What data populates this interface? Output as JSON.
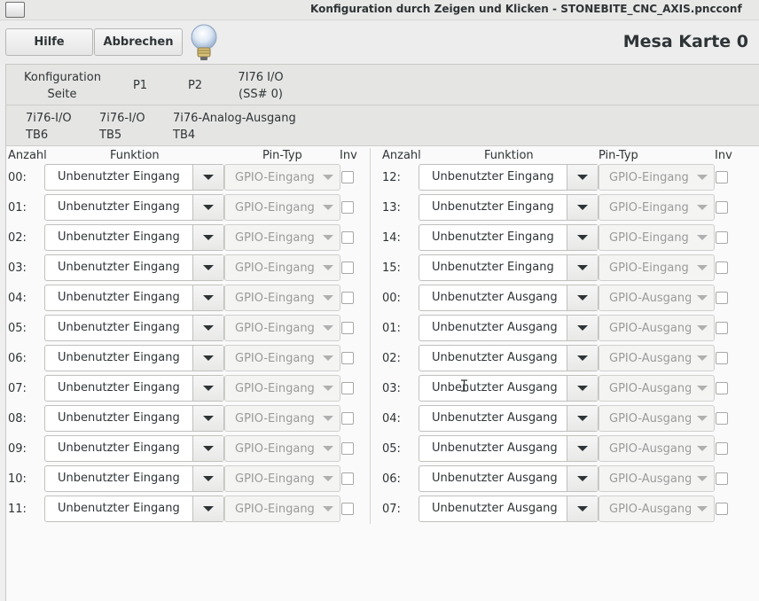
{
  "window": {
    "title": "Konfiguration durch Zeigen und Klicken - STONEBITE_CNC_AXIS.pncconf"
  },
  "toolbar": {
    "help_label": "Hilfe",
    "cancel_label": "Abbrechen",
    "card_title": "Mesa Karte 0"
  },
  "tabs": [
    {
      "line1": "Konfiguration",
      "line2": "Seite"
    },
    {
      "line1": "P1",
      "line2": ""
    },
    {
      "line1": "P2",
      "line2": ""
    },
    {
      "line1": "7I76 I/O",
      "line2": "(SS# 0)"
    }
  ],
  "subtabs": [
    {
      "line1": "7i76-I/O",
      "line2": "TB6"
    },
    {
      "line1": "7i76-I/O",
      "line2": "TB5"
    },
    {
      "line1": "7i76-Analog-Ausgang",
      "line2": "TB4"
    }
  ],
  "headers": {
    "num": "Anzahl",
    "function": "Funktion",
    "pintype": "Pin-Typ",
    "inv": "Inv"
  },
  "left_rows": [
    {
      "num": "00:",
      "function": "Unbenutzter Eingang",
      "pintype": "GPIO-Eingang"
    },
    {
      "num": "01:",
      "function": "Unbenutzter Eingang",
      "pintype": "GPIO-Eingang"
    },
    {
      "num": "02:",
      "function": "Unbenutzter Eingang",
      "pintype": "GPIO-Eingang"
    },
    {
      "num": "03:",
      "function": "Unbenutzter Eingang",
      "pintype": "GPIO-Eingang"
    },
    {
      "num": "04:",
      "function": "Unbenutzter Eingang",
      "pintype": "GPIO-Eingang"
    },
    {
      "num": "05:",
      "function": "Unbenutzter Eingang",
      "pintype": "GPIO-Eingang"
    },
    {
      "num": "06:",
      "function": "Unbenutzter Eingang",
      "pintype": "GPIO-Eingang"
    },
    {
      "num": "07:",
      "function": "Unbenutzter Eingang",
      "pintype": "GPIO-Eingang"
    },
    {
      "num": "08:",
      "function": "Unbenutzter Eingang",
      "pintype": "GPIO-Eingang"
    },
    {
      "num": "09:",
      "function": "Unbenutzter Eingang",
      "pintype": "GPIO-Eingang"
    },
    {
      "num": "10:",
      "function": "Unbenutzter Eingang",
      "pintype": "GPIO-Eingang"
    },
    {
      "num": "11:",
      "function": "Unbenutzter Eingang",
      "pintype": "GPIO-Eingang"
    }
  ],
  "right_rows": [
    {
      "num": "12:",
      "function": "Unbenutzter Eingang",
      "pintype": "GPIO-Eingang"
    },
    {
      "num": "13:",
      "function": "Unbenutzter Eingang",
      "pintype": "GPIO-Eingang"
    },
    {
      "num": "14:",
      "function": "Unbenutzter Eingang",
      "pintype": "GPIO-Eingang"
    },
    {
      "num": "15:",
      "function": "Unbenutzter Eingang",
      "pintype": "GPIO-Eingang"
    },
    {
      "num": "00:",
      "function": "Unbenutzter Ausgang",
      "pintype": "GPIO-Ausgang"
    },
    {
      "num": "01:",
      "function": "Unbenutzter Ausgang",
      "pintype": "GPIO-Ausgang"
    },
    {
      "num": "02:",
      "function": "Unbenutzter Ausgang",
      "pintype": "GPIO-Ausgang"
    },
    {
      "num": "03:",
      "function": "Unbenutzter Ausgang",
      "pintype": "GPIO-Ausgang"
    },
    {
      "num": "04:",
      "function": "Unbenutzter Ausgang",
      "pintype": "GPIO-Ausgang"
    },
    {
      "num": "05:",
      "function": "Unbenutzter Ausgang",
      "pintype": "GPIO-Ausgang"
    },
    {
      "num": "06:",
      "function": "Unbenutzter Ausgang",
      "pintype": "GPIO-Ausgang"
    },
    {
      "num": "07:",
      "function": "Unbenutzter Ausgang",
      "pintype": "GPIO-Ausgang"
    }
  ],
  "colors": {
    "accent": "#3584e4"
  }
}
